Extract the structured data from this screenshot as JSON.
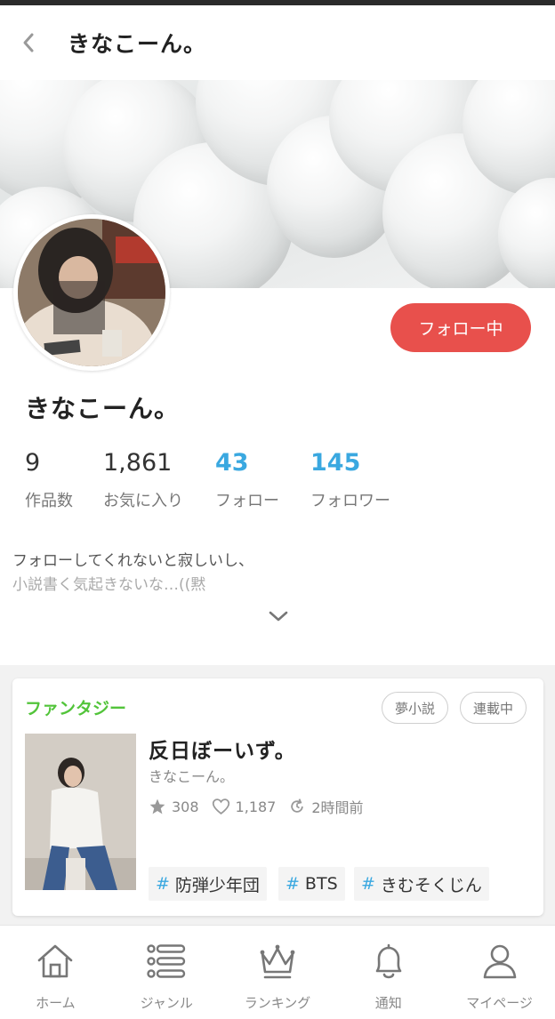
{
  "header": {
    "title": "きなこーん。",
    "back_icon": "chevron-left-icon"
  },
  "profile": {
    "name": "きなこーん。",
    "follow_button": "フォロー中",
    "stats": [
      {
        "value": "9",
        "label": "作品数",
        "highlight": false
      },
      {
        "value": "1,861",
        "label": "お気に入り",
        "highlight": false
      },
      {
        "value": "43",
        "label": "フォロー",
        "highlight": true
      },
      {
        "value": "145",
        "label": "フォロワー",
        "highlight": true
      }
    ],
    "bio_line1": "フォローしてくれないと寂しいし、",
    "bio_line2": "小説書く気起きないな…((黙"
  },
  "work": {
    "genre": "ファンタジー",
    "tags": [
      "夢小説",
      "連載中"
    ],
    "title": "反日ぼーいず。",
    "author": "きなこーん。",
    "stars": "308",
    "likes": "1,187",
    "updated": "2時間前",
    "hashtags": [
      "防弾少年団",
      "BTS",
      "きむそくじん"
    ]
  },
  "nav": [
    {
      "label": "ホーム",
      "icon": "home-icon"
    },
    {
      "label": "ジャンル",
      "icon": "list-icon"
    },
    {
      "label": "ランキング",
      "icon": "crown-icon"
    },
    {
      "label": "通知",
      "icon": "bell-icon"
    },
    {
      "label": "マイページ",
      "icon": "user-icon"
    }
  ],
  "colors": {
    "accent": "#e8504c",
    "link": "#3aa8e0",
    "genre": "#52c43a"
  }
}
